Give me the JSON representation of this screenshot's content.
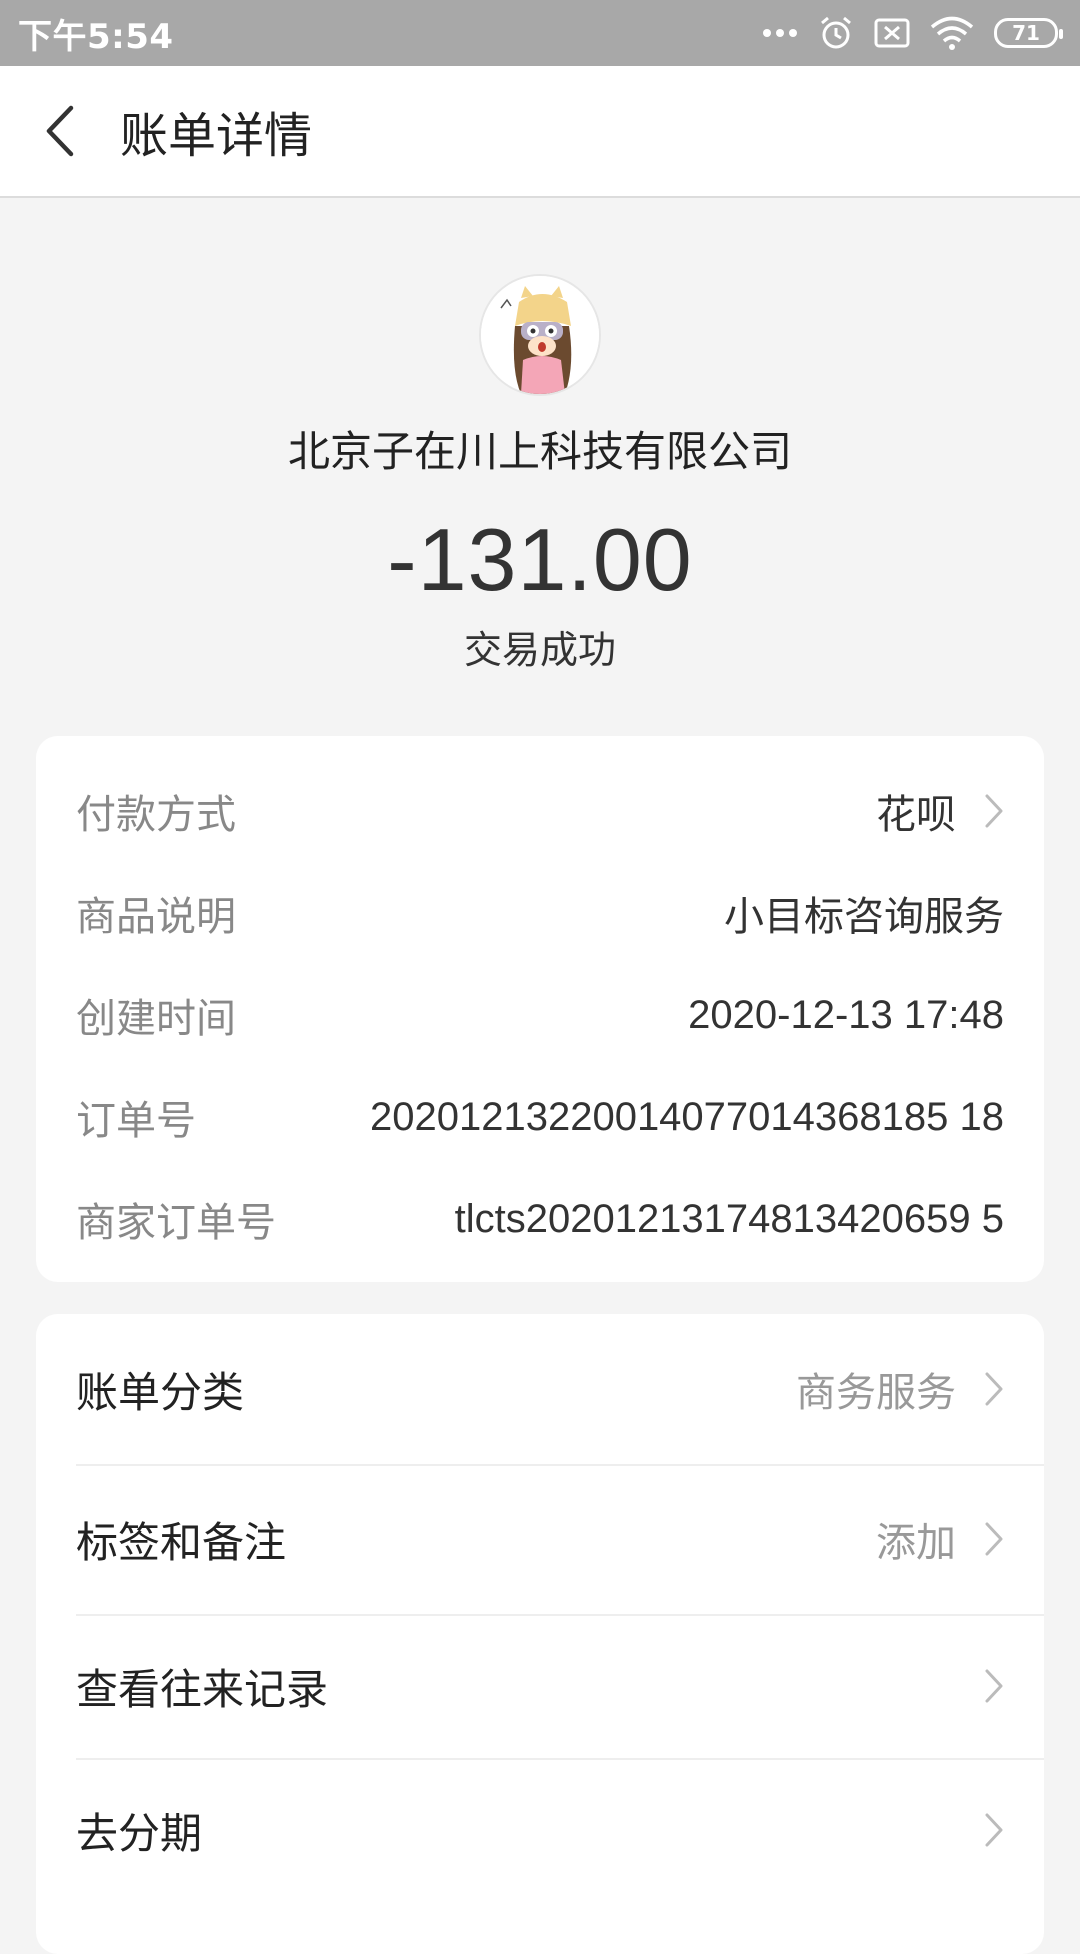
{
  "status_bar": {
    "time": "下午5:54",
    "battery": "71",
    "icons": [
      "more-dots-icon",
      "alarm-icon",
      "sim-off-icon",
      "wifi-icon",
      "battery-icon"
    ]
  },
  "nav": {
    "title": "账单详情",
    "back_icon": "chevron-left-icon"
  },
  "header": {
    "merchant_name": "北京子在川上科技有限公司",
    "amount": "-131.00",
    "status": "交易成功"
  },
  "details": {
    "rows": [
      {
        "label": "付款方式",
        "value": "花呗"
      },
      {
        "label": "商品说明",
        "value": "小目标咨询服务"
      },
      {
        "label": "创建时间",
        "value": "2020-12-13 17:48"
      },
      {
        "label": "订单号",
        "value": "20201213220014077014368185 18"
      },
      {
        "label": "商家订单号",
        "value": "tlcts20201213174813420659 5"
      }
    ]
  },
  "actions": {
    "rows": [
      {
        "label": "账单分类",
        "value": "商务服务"
      },
      {
        "label": "标签和备注",
        "value": "添加"
      },
      {
        "label": "查看往来记录",
        "value": ""
      },
      {
        "label": "去分期",
        "value": ""
      }
    ]
  },
  "colors": {
    "status_bar_bg": "#a8a8a8",
    "page_bg": "#f4f4f4",
    "card_bg": "#ffffff",
    "label_gray": "#888888",
    "text_dark": "#333333"
  }
}
